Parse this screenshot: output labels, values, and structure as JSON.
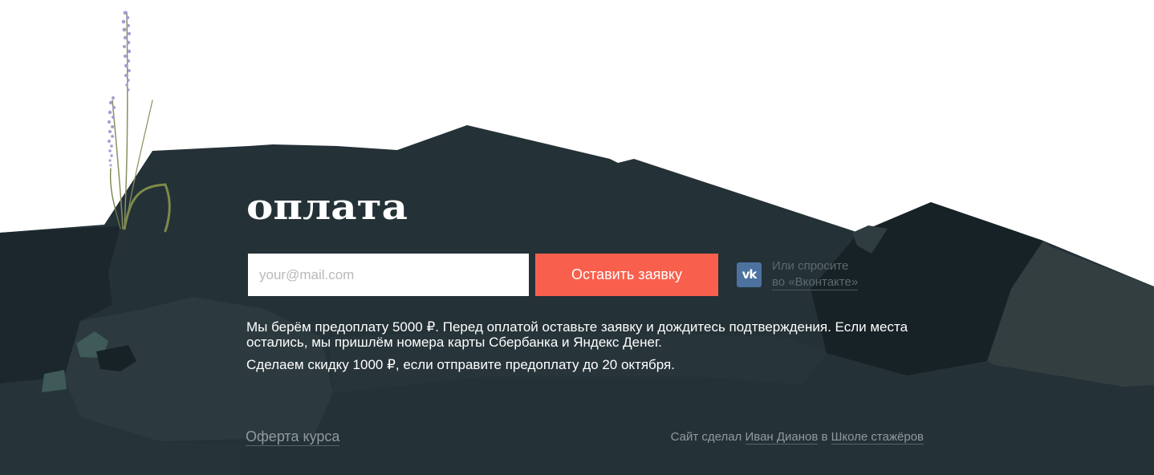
{
  "section": {
    "title": "оплата"
  },
  "form": {
    "email_placeholder": "your@mail.com",
    "email_value": "",
    "submit_label": "Оставить заявку"
  },
  "vk": {
    "icon": "vk-icon",
    "icon_glyph": "vk",
    "line1": "Или спросите",
    "line2": "во «Вконтакте»"
  },
  "info": {
    "paragraph1": "Мы берём предоплату 5000 ₽. Перед оплатой оставьте заявку и дождитесь подтверждения. Если места остались, мы пришлём номера карты Сбербанка и Яндекс Денег.",
    "paragraph2": "Сделаем скидку 1000 ₽, если отправите предоплату до 20 октября."
  },
  "footer": {
    "offer_link": "Оферта курса",
    "credits_prefix": "Сайт сделал",
    "author_link": "Иван Дианов",
    "credits_middle": "в",
    "school_link": "Школе стажёров"
  },
  "colors": {
    "background": "#ffffff",
    "mountain_dark": "#243137",
    "accent_button": "#f8604d",
    "vk_blue": "#4d72a0",
    "flower_lavender": "#a99ad3",
    "stem_green": "#7d8a4a"
  }
}
